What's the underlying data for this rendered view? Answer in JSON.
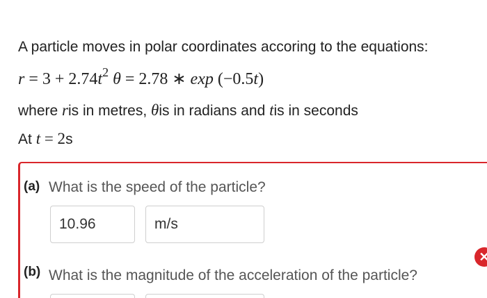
{
  "problem": {
    "intro": "A particle moves in polar coordinates accoring to the equations:",
    "equation": {
      "r_sym": "r",
      "r_rhs_a": " = 3 + 2.74",
      "t_sym": "t",
      "exp_power": "2",
      "theta_sym": "θ",
      "theta_rhs_a": " = 2.78 ∗ ",
      "exp_word": "exp",
      "theta_rhs_b": " (−0.5",
      "close": ")"
    },
    "units": {
      "where": "where ",
      "r_sym": "r",
      "r_desc": "is in metres, ",
      "theta_sym": "θ",
      "theta_desc": "is in radians and ",
      "t_sym": "t",
      "t_desc": "is in seconds"
    },
    "at": {
      "prefix": "At ",
      "t_sym": "t",
      "equals": " = 2",
      "unit": "s"
    }
  },
  "parts": [
    {
      "label": "(a)",
      "question": "What is the speed of the particle?",
      "answer_value": "10.96",
      "answer_unit": "m/s"
    },
    {
      "label": "(b)",
      "question": "What is the magnitude of the acceleration of the particle?"
    }
  ],
  "colors": {
    "error": "#d9262b",
    "field_border": "#cfcfcf"
  },
  "icons": {
    "status": "error-x-icon"
  }
}
